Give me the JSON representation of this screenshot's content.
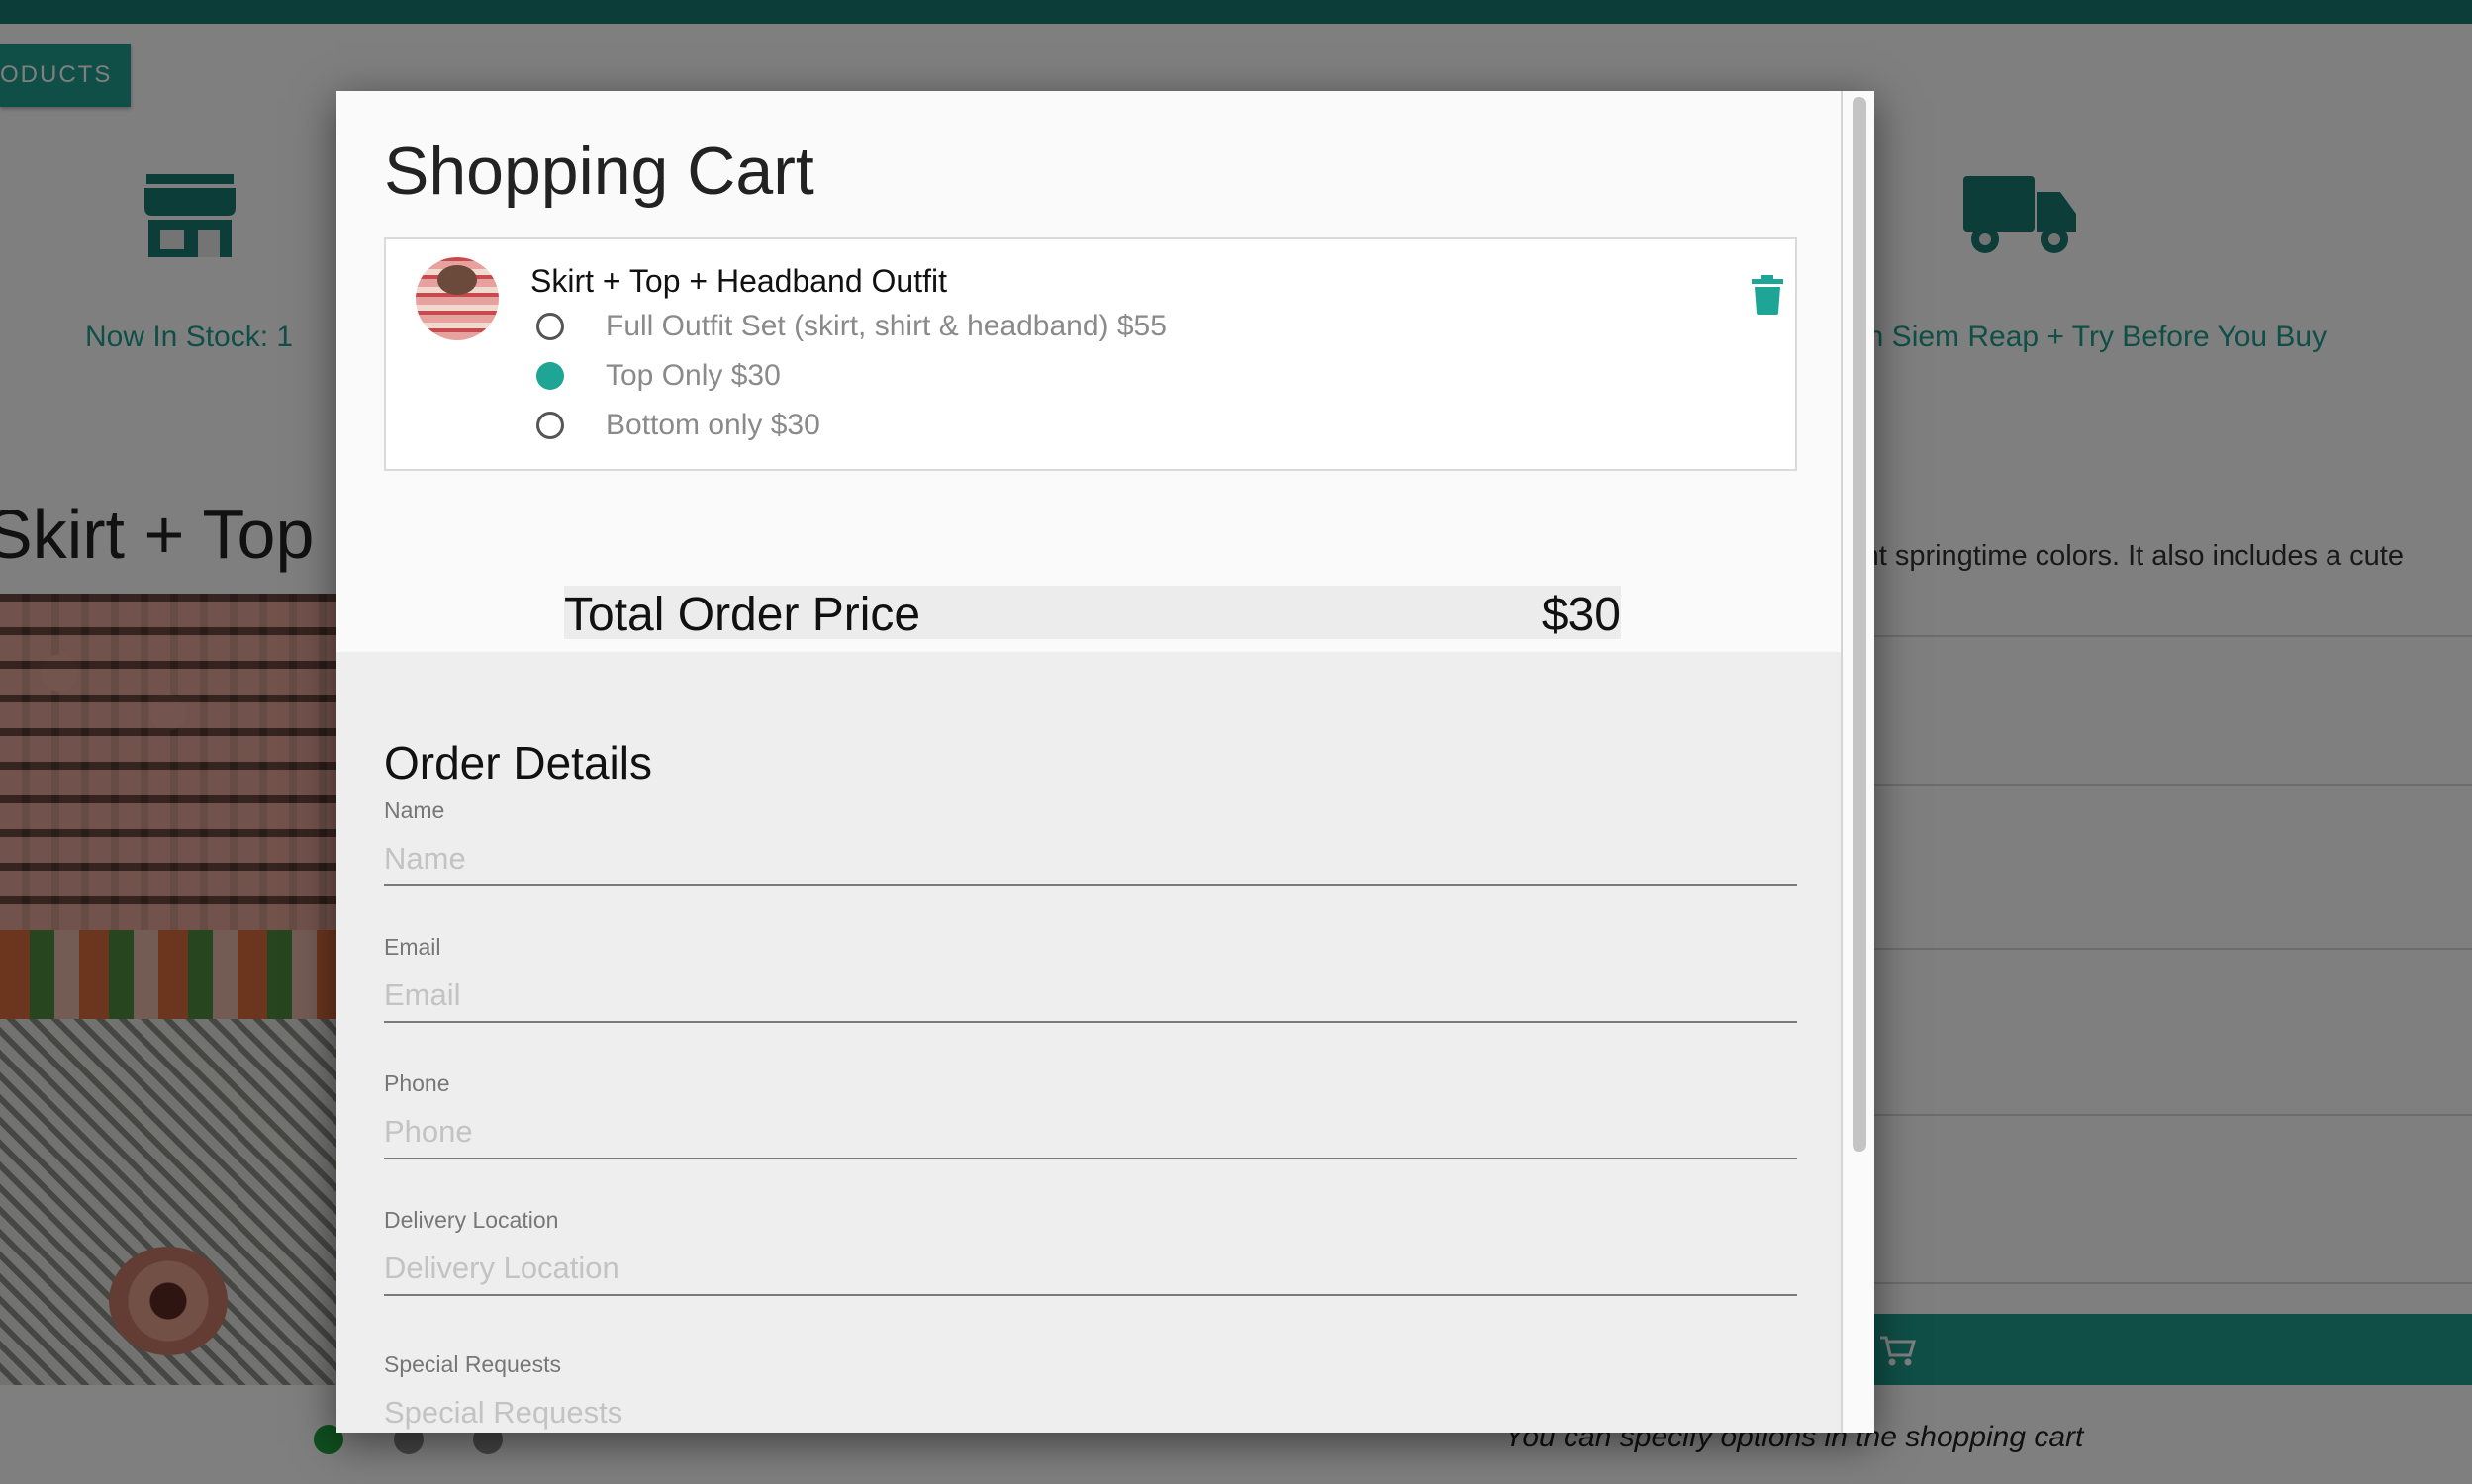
{
  "background_page": {
    "products_button": "ODUCTS",
    "stock_text": "Now In Stock: 1",
    "delivery_text": "in Siem Reap + Try Before You Buy",
    "product_title": "Skirt + Top +",
    "description_fragment": "ight springtime colors. It also includes a cute",
    "cart_note": "You can specify options in the shopping cart",
    "accent_color": "#1f9f8e",
    "carousel_dots": [
      "active",
      "inactive",
      "inactive"
    ]
  },
  "modal": {
    "title": "Shopping Cart",
    "cart_items": [
      {
        "name": "Skirt + Top + Headband Outfit",
        "options": [
          {
            "label": "Full Outfit Set (skirt, shirt & headband) $55",
            "selected": false
          },
          {
            "label": "Top Only $30",
            "selected": true
          },
          {
            "label": "Bottom only $30",
            "selected": false
          }
        ],
        "remove_icon": "trash-icon"
      }
    ],
    "total_label": "Total Order Price",
    "total_value": "$30",
    "order_details": {
      "title": "Order Details",
      "fields": [
        {
          "label": "Name",
          "placeholder": "Name",
          "value": ""
        },
        {
          "label": "Email",
          "placeholder": "Email",
          "value": ""
        },
        {
          "label": "Phone",
          "placeholder": "Phone",
          "value": ""
        },
        {
          "label": "Delivery Location",
          "placeholder": "Delivery Location",
          "value": ""
        },
        {
          "label": "Special Requests",
          "placeholder": "Special Requests",
          "value": ""
        }
      ]
    }
  }
}
